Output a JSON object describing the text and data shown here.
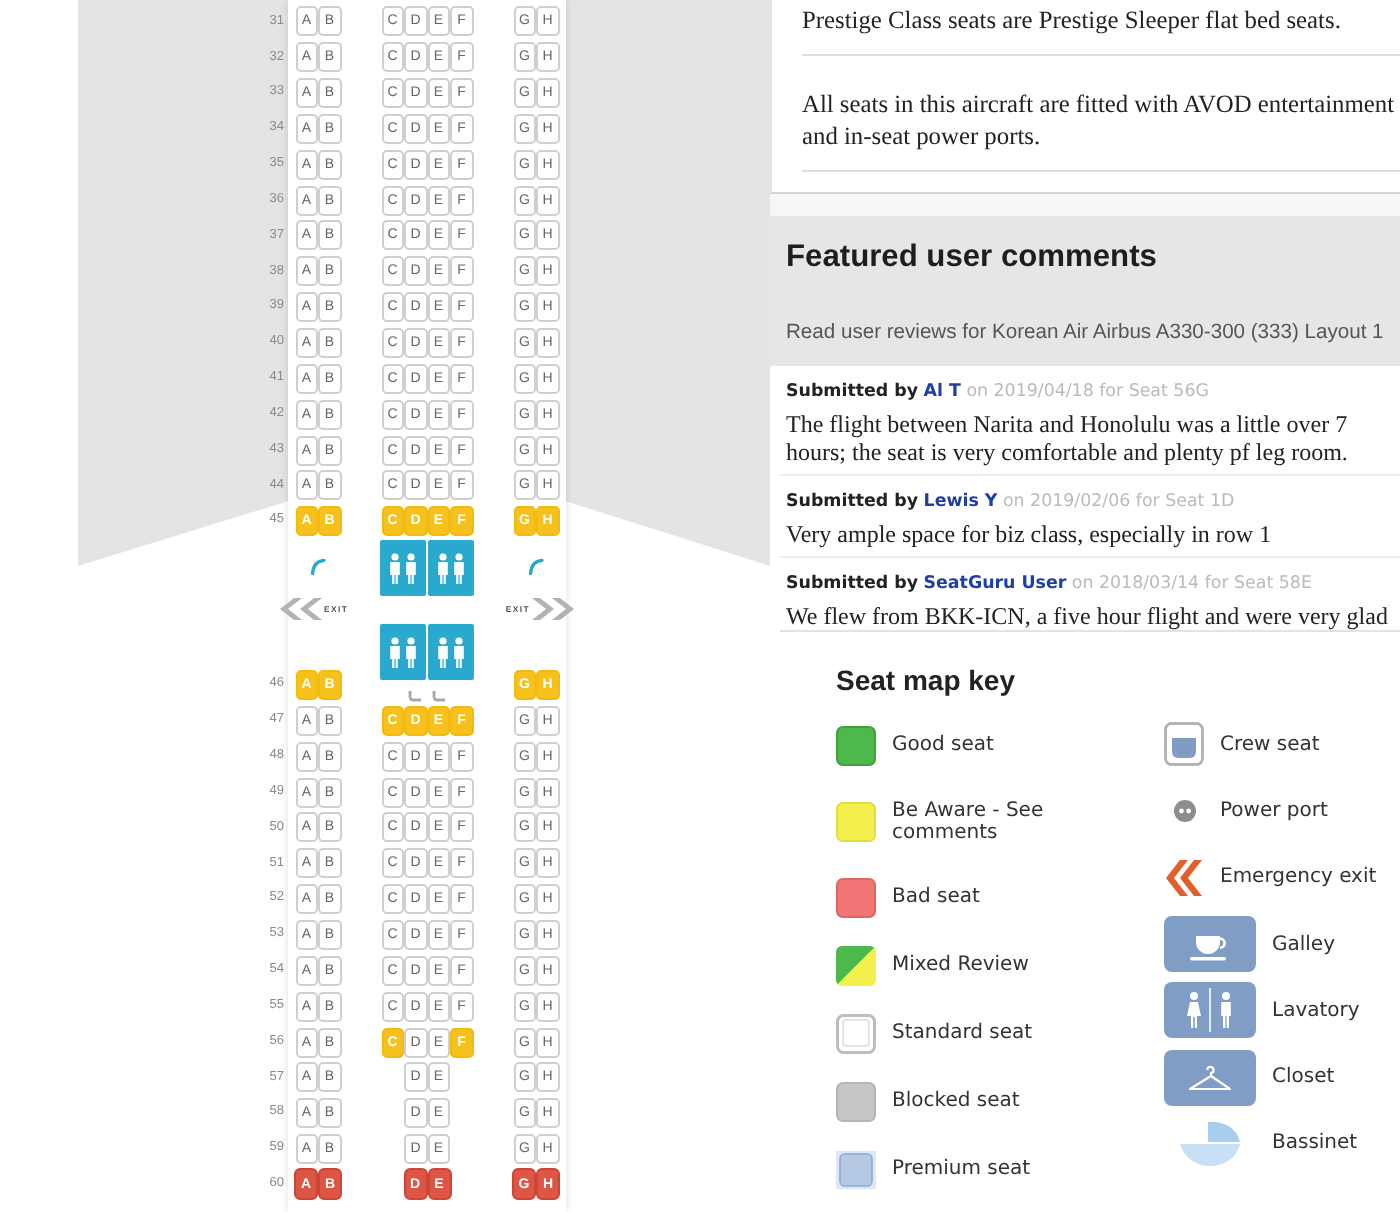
{
  "cabin": [
    {
      "kind": "seats",
      "number": "31",
      "left": [
        {
          "letter": "A",
          "kind": "standard"
        },
        {
          "letter": "B",
          "kind": "standard"
        }
      ],
      "center": [
        {
          "letter": "C",
          "kind": "standard"
        },
        {
          "letter": "D",
          "kind": "standard"
        },
        {
          "letter": "E",
          "kind": "standard"
        },
        {
          "letter": "F",
          "kind": "standard"
        }
      ],
      "right": [
        {
          "letter": "G",
          "kind": "standard"
        },
        {
          "letter": "H",
          "kind": "standard"
        }
      ]
    },
    {
      "kind": "seats",
      "number": "32",
      "left": [
        {
          "letter": "A",
          "kind": "standard"
        },
        {
          "letter": "B",
          "kind": "standard"
        }
      ],
      "center": [
        {
          "letter": "C",
          "kind": "standard"
        },
        {
          "letter": "D",
          "kind": "standard"
        },
        {
          "letter": "E",
          "kind": "standard"
        },
        {
          "letter": "F",
          "kind": "standard"
        }
      ],
      "right": [
        {
          "letter": "G",
          "kind": "standard"
        },
        {
          "letter": "H",
          "kind": "standard"
        }
      ]
    },
    {
      "kind": "seats",
      "number": "33",
      "left": [
        {
          "letter": "A",
          "kind": "standard"
        },
        {
          "letter": "B",
          "kind": "standard"
        }
      ],
      "center": [
        {
          "letter": "C",
          "kind": "standard"
        },
        {
          "letter": "D",
          "kind": "standard"
        },
        {
          "letter": "E",
          "kind": "standard"
        },
        {
          "letter": "F",
          "kind": "standard"
        }
      ],
      "right": [
        {
          "letter": "G",
          "kind": "standard"
        },
        {
          "letter": "H",
          "kind": "standard"
        }
      ]
    },
    {
      "kind": "seats",
      "number": "34",
      "left": [
        {
          "letter": "A",
          "kind": "standard"
        },
        {
          "letter": "B",
          "kind": "standard"
        }
      ],
      "center": [
        {
          "letter": "C",
          "kind": "standard"
        },
        {
          "letter": "D",
          "kind": "standard"
        },
        {
          "letter": "E",
          "kind": "standard"
        },
        {
          "letter": "F",
          "kind": "standard"
        }
      ],
      "right": [
        {
          "letter": "G",
          "kind": "standard"
        },
        {
          "letter": "H",
          "kind": "standard"
        }
      ]
    },
    {
      "kind": "seats",
      "number": "35",
      "left": [
        {
          "letter": "A",
          "kind": "standard"
        },
        {
          "letter": "B",
          "kind": "standard"
        }
      ],
      "center": [
        {
          "letter": "C",
          "kind": "standard"
        },
        {
          "letter": "D",
          "kind": "standard"
        },
        {
          "letter": "E",
          "kind": "standard"
        },
        {
          "letter": "F",
          "kind": "standard"
        }
      ],
      "right": [
        {
          "letter": "G",
          "kind": "standard"
        },
        {
          "letter": "H",
          "kind": "standard"
        }
      ]
    },
    {
      "kind": "seats",
      "number": "36",
      "left": [
        {
          "letter": "A",
          "kind": "standard"
        },
        {
          "letter": "B",
          "kind": "standard"
        }
      ],
      "center": [
        {
          "letter": "C",
          "kind": "standard"
        },
        {
          "letter": "D",
          "kind": "standard"
        },
        {
          "letter": "E",
          "kind": "standard"
        },
        {
          "letter": "F",
          "kind": "standard"
        }
      ],
      "right": [
        {
          "letter": "G",
          "kind": "standard"
        },
        {
          "letter": "H",
          "kind": "standard"
        }
      ]
    },
    {
      "kind": "seats",
      "number": "37",
      "left": [
        {
          "letter": "A",
          "kind": "standard"
        },
        {
          "letter": "B",
          "kind": "standard"
        }
      ],
      "center": [
        {
          "letter": "C",
          "kind": "standard"
        },
        {
          "letter": "D",
          "kind": "standard"
        },
        {
          "letter": "E",
          "kind": "standard"
        },
        {
          "letter": "F",
          "kind": "standard"
        }
      ],
      "right": [
        {
          "letter": "G",
          "kind": "standard"
        },
        {
          "letter": "H",
          "kind": "standard"
        }
      ]
    },
    {
      "kind": "seats",
      "number": "38",
      "left": [
        {
          "letter": "A",
          "kind": "standard"
        },
        {
          "letter": "B",
          "kind": "standard"
        }
      ],
      "center": [
        {
          "letter": "C",
          "kind": "standard"
        },
        {
          "letter": "D",
          "kind": "standard"
        },
        {
          "letter": "E",
          "kind": "standard"
        },
        {
          "letter": "F",
          "kind": "standard"
        }
      ],
      "right": [
        {
          "letter": "G",
          "kind": "standard"
        },
        {
          "letter": "H",
          "kind": "standard"
        }
      ]
    },
    {
      "kind": "seats",
      "number": "39",
      "left": [
        {
          "letter": "A",
          "kind": "standard"
        },
        {
          "letter": "B",
          "kind": "standard"
        }
      ],
      "center": [
        {
          "letter": "C",
          "kind": "standard"
        },
        {
          "letter": "D",
          "kind": "standard"
        },
        {
          "letter": "E",
          "kind": "standard"
        },
        {
          "letter": "F",
          "kind": "standard"
        }
      ],
      "right": [
        {
          "letter": "G",
          "kind": "standard"
        },
        {
          "letter": "H",
          "kind": "standard"
        }
      ]
    },
    {
      "kind": "seats",
      "number": "40",
      "left": [
        {
          "letter": "A",
          "kind": "standard"
        },
        {
          "letter": "B",
          "kind": "standard"
        }
      ],
      "center": [
        {
          "letter": "C",
          "kind": "standard"
        },
        {
          "letter": "D",
          "kind": "standard"
        },
        {
          "letter": "E",
          "kind": "standard"
        },
        {
          "letter": "F",
          "kind": "standard"
        }
      ],
      "right": [
        {
          "letter": "G",
          "kind": "standard"
        },
        {
          "letter": "H",
          "kind": "standard"
        }
      ]
    },
    {
      "kind": "seats",
      "number": "41",
      "left": [
        {
          "letter": "A",
          "kind": "standard"
        },
        {
          "letter": "B",
          "kind": "standard"
        }
      ],
      "center": [
        {
          "letter": "C",
          "kind": "standard"
        },
        {
          "letter": "D",
          "kind": "standard"
        },
        {
          "letter": "E",
          "kind": "standard"
        },
        {
          "letter": "F",
          "kind": "standard"
        }
      ],
      "right": [
        {
          "letter": "G",
          "kind": "standard"
        },
        {
          "letter": "H",
          "kind": "standard"
        }
      ]
    },
    {
      "kind": "seats",
      "number": "42",
      "left": [
        {
          "letter": "A",
          "kind": "standard"
        },
        {
          "letter": "B",
          "kind": "standard"
        }
      ],
      "center": [
        {
          "letter": "C",
          "kind": "standard"
        },
        {
          "letter": "D",
          "kind": "standard"
        },
        {
          "letter": "E",
          "kind": "standard"
        },
        {
          "letter": "F",
          "kind": "standard"
        }
      ],
      "right": [
        {
          "letter": "G",
          "kind": "standard"
        },
        {
          "letter": "H",
          "kind": "standard"
        }
      ]
    },
    {
      "kind": "seats",
      "number": "43",
      "left": [
        {
          "letter": "A",
          "kind": "standard"
        },
        {
          "letter": "B",
          "kind": "standard"
        }
      ],
      "center": [
        {
          "letter": "C",
          "kind": "standard"
        },
        {
          "letter": "D",
          "kind": "standard"
        },
        {
          "letter": "E",
          "kind": "standard"
        },
        {
          "letter": "F",
          "kind": "standard"
        }
      ],
      "right": [
        {
          "letter": "G",
          "kind": "standard"
        },
        {
          "letter": "H",
          "kind": "standard"
        }
      ]
    },
    {
      "kind": "seats",
      "number": "44",
      "left": [
        {
          "letter": "A",
          "kind": "standard"
        },
        {
          "letter": "B",
          "kind": "standard"
        }
      ],
      "center": [
        {
          "letter": "C",
          "kind": "standard"
        },
        {
          "letter": "D",
          "kind": "standard"
        },
        {
          "letter": "E",
          "kind": "standard"
        },
        {
          "letter": "F",
          "kind": "standard"
        }
      ],
      "right": [
        {
          "letter": "G",
          "kind": "standard"
        },
        {
          "letter": "H",
          "kind": "standard"
        }
      ]
    },
    {
      "kind": "seats",
      "number": "45",
      "left": [
        {
          "letter": "A",
          "kind": "be_aware"
        },
        {
          "letter": "B",
          "kind": "be_aware"
        }
      ],
      "center": [
        {
          "letter": "C",
          "kind": "be_aware"
        },
        {
          "letter": "D",
          "kind": "be_aware"
        },
        {
          "letter": "E",
          "kind": "be_aware"
        },
        {
          "letter": "F",
          "kind": "be_aware"
        }
      ],
      "right": [
        {
          "letter": "G",
          "kind": "be_aware"
        },
        {
          "letter": "H",
          "kind": "be_aware"
        }
      ]
    },
    {
      "kind": "exit_zone",
      "exit_labels": [
        "EXIT",
        "EXIT"
      ]
    },
    {
      "kind": "seats",
      "number": "46",
      "left": [
        {
          "letter": "A",
          "kind": "be_aware"
        },
        {
          "letter": "B",
          "kind": "be_aware"
        }
      ],
      "center": [
        {
          "kind": "curl"
        },
        {
          "kind": "curl"
        }
      ],
      "right": [
        {
          "letter": "G",
          "kind": "be_aware"
        },
        {
          "letter": "H",
          "kind": "be_aware"
        }
      ]
    },
    {
      "kind": "seats",
      "number": "47",
      "left": [
        {
          "letter": "A",
          "kind": "standard"
        },
        {
          "letter": "B",
          "kind": "standard"
        }
      ],
      "center": [
        {
          "letter": "C",
          "kind": "be_aware"
        },
        {
          "letter": "D",
          "kind": "be_aware"
        },
        {
          "letter": "E",
          "kind": "be_aware"
        },
        {
          "letter": "F",
          "kind": "be_aware"
        }
      ],
      "right": [
        {
          "letter": "G",
          "kind": "standard"
        },
        {
          "letter": "H",
          "kind": "standard"
        }
      ]
    },
    {
      "kind": "seats",
      "number": "48",
      "left": [
        {
          "letter": "A",
          "kind": "standard"
        },
        {
          "letter": "B",
          "kind": "standard"
        }
      ],
      "center": [
        {
          "letter": "C",
          "kind": "standard"
        },
        {
          "letter": "D",
          "kind": "standard"
        },
        {
          "letter": "E",
          "kind": "standard"
        },
        {
          "letter": "F",
          "kind": "standard"
        }
      ],
      "right": [
        {
          "letter": "G",
          "kind": "standard"
        },
        {
          "letter": "H",
          "kind": "standard"
        }
      ]
    },
    {
      "kind": "seats",
      "number": "49",
      "left": [
        {
          "letter": "A",
          "kind": "standard"
        },
        {
          "letter": "B",
          "kind": "standard"
        }
      ],
      "center": [
        {
          "letter": "C",
          "kind": "standard"
        },
        {
          "letter": "D",
          "kind": "standard"
        },
        {
          "letter": "E",
          "kind": "standard"
        },
        {
          "letter": "F",
          "kind": "standard"
        }
      ],
      "right": [
        {
          "letter": "G",
          "kind": "standard"
        },
        {
          "letter": "H",
          "kind": "standard"
        }
      ]
    },
    {
      "kind": "seats",
      "number": "50",
      "left": [
        {
          "letter": "A",
          "kind": "standard"
        },
        {
          "letter": "B",
          "kind": "standard"
        }
      ],
      "center": [
        {
          "letter": "C",
          "kind": "standard"
        },
        {
          "letter": "D",
          "kind": "standard"
        },
        {
          "letter": "E",
          "kind": "standard"
        },
        {
          "letter": "F",
          "kind": "standard"
        }
      ],
      "right": [
        {
          "letter": "G",
          "kind": "standard"
        },
        {
          "letter": "H",
          "kind": "standard"
        }
      ]
    },
    {
      "kind": "seats",
      "number": "51",
      "left": [
        {
          "letter": "A",
          "kind": "standard"
        },
        {
          "letter": "B",
          "kind": "standard"
        }
      ],
      "center": [
        {
          "letter": "C",
          "kind": "standard"
        },
        {
          "letter": "D",
          "kind": "standard"
        },
        {
          "letter": "E",
          "kind": "standard"
        },
        {
          "letter": "F",
          "kind": "standard"
        }
      ],
      "right": [
        {
          "letter": "G",
          "kind": "standard"
        },
        {
          "letter": "H",
          "kind": "standard"
        }
      ]
    },
    {
      "kind": "seats",
      "number": "52",
      "left": [
        {
          "letter": "A",
          "kind": "standard"
        },
        {
          "letter": "B",
          "kind": "standard"
        }
      ],
      "center": [
        {
          "letter": "C",
          "kind": "standard"
        },
        {
          "letter": "D",
          "kind": "standard"
        },
        {
          "letter": "E",
          "kind": "standard"
        },
        {
          "letter": "F",
          "kind": "standard"
        }
      ],
      "right": [
        {
          "letter": "G",
          "kind": "standard"
        },
        {
          "letter": "H",
          "kind": "standard"
        }
      ]
    },
    {
      "kind": "seats",
      "number": "53",
      "left": [
        {
          "letter": "A",
          "kind": "standard"
        },
        {
          "letter": "B",
          "kind": "standard"
        }
      ],
      "center": [
        {
          "letter": "C",
          "kind": "standard"
        },
        {
          "letter": "D",
          "kind": "standard"
        },
        {
          "letter": "E",
          "kind": "standard"
        },
        {
          "letter": "F",
          "kind": "standard"
        }
      ],
      "right": [
        {
          "letter": "G",
          "kind": "standard"
        },
        {
          "letter": "H",
          "kind": "standard"
        }
      ]
    },
    {
      "kind": "seats",
      "number": "54",
      "left": [
        {
          "letter": "A",
          "kind": "standard"
        },
        {
          "letter": "B",
          "kind": "standard"
        }
      ],
      "center": [
        {
          "letter": "C",
          "kind": "standard"
        },
        {
          "letter": "D",
          "kind": "standard"
        },
        {
          "letter": "E",
          "kind": "standard"
        },
        {
          "letter": "F",
          "kind": "standard"
        }
      ],
      "right": [
        {
          "letter": "G",
          "kind": "standard"
        },
        {
          "letter": "H",
          "kind": "standard"
        }
      ]
    },
    {
      "kind": "seats",
      "number": "55",
      "left": [
        {
          "letter": "A",
          "kind": "standard"
        },
        {
          "letter": "B",
          "kind": "standard"
        }
      ],
      "center": [
        {
          "letter": "C",
          "kind": "standard"
        },
        {
          "letter": "D",
          "kind": "standard"
        },
        {
          "letter": "E",
          "kind": "standard"
        },
        {
          "letter": "F",
          "kind": "standard"
        }
      ],
      "right": [
        {
          "letter": "G",
          "kind": "standard"
        },
        {
          "letter": "H",
          "kind": "standard"
        }
      ]
    },
    {
      "kind": "seats",
      "number": "56",
      "left": [
        {
          "letter": "A",
          "kind": "standard"
        },
        {
          "letter": "B",
          "kind": "standard"
        }
      ],
      "center": [
        {
          "letter": "C",
          "kind": "be_aware"
        },
        {
          "letter": "D",
          "kind": "standard"
        },
        {
          "letter": "E",
          "kind": "standard"
        },
        {
          "letter": "F",
          "kind": "be_aware"
        }
      ],
      "right": [
        {
          "letter": "G",
          "kind": "standard"
        },
        {
          "letter": "H",
          "kind": "standard"
        }
      ]
    },
    {
      "kind": "seats",
      "number": "57",
      "left": [
        {
          "letter": "A",
          "kind": "standard"
        },
        {
          "letter": "B",
          "kind": "standard"
        }
      ],
      "center": [
        {
          "letter": "D",
          "kind": "standard"
        },
        {
          "letter": "E",
          "kind": "standard"
        }
      ],
      "right": [
        {
          "letter": "G",
          "kind": "standard"
        },
        {
          "letter": "H",
          "kind": "standard"
        }
      ]
    },
    {
      "kind": "seats",
      "number": "58",
      "left": [
        {
          "letter": "A",
          "kind": "standard"
        },
        {
          "letter": "B",
          "kind": "standard"
        }
      ],
      "center": [
        {
          "letter": "D",
          "kind": "standard"
        },
        {
          "letter": "E",
          "kind": "standard"
        }
      ],
      "right": [
        {
          "letter": "G",
          "kind": "standard"
        },
        {
          "letter": "H",
          "kind": "standard"
        }
      ]
    },
    {
      "kind": "seats",
      "number": "59",
      "left": [
        {
          "letter": "A",
          "kind": "standard"
        },
        {
          "letter": "B",
          "kind": "standard"
        }
      ],
      "center": [
        {
          "letter": "D",
          "kind": "standard"
        },
        {
          "letter": "E",
          "kind": "standard"
        }
      ],
      "right": [
        {
          "letter": "G",
          "kind": "standard"
        },
        {
          "letter": "H",
          "kind": "standard"
        }
      ]
    },
    {
      "kind": "seats",
      "number": "60",
      "left": [
        {
          "letter": "A",
          "kind": "bad"
        },
        {
          "letter": "B",
          "kind": "bad"
        }
      ],
      "center": [
        {
          "letter": "D",
          "kind": "bad"
        },
        {
          "letter": "E",
          "kind": "bad"
        }
      ],
      "right": [
        {
          "letter": "G",
          "kind": "bad"
        },
        {
          "letter": "H",
          "kind": "bad"
        }
      ]
    }
  ],
  "info_notes": [
    "Prestige Class seats are Prestige Sleeper flat bed seats.",
    "All seats in this aircraft are fitted with AVOD entertainment and in-seat power ports."
  ],
  "featured_comments": {
    "title": "Featured user comments",
    "subtitle": "Read user reviews for Korean Air Airbus A330-300 (333) Layout 1",
    "comments": [
      {
        "label": "Submitted by",
        "author": "Al T",
        "details": "on 2019/04/18 for Seat 56G",
        "text": "The flight between Narita and Honolulu was a little over 7 hours; the seat is very comfortable and plenty pf leg room."
      },
      {
        "label": "Submitted by",
        "author": "Lewis Y",
        "details": "on 2019/02/06 for Seat 1D",
        "text": "Very ample space for biz class, especially in row 1"
      },
      {
        "label": "Submitted by",
        "author": "SeatGuru User",
        "details": "on 2018/03/14 for Seat 58E",
        "text": "We flew from BKK-ICN, a five hour flight and were very glad"
      }
    ]
  },
  "seat_map_key": {
    "title": "Seat map key",
    "left_items": [
      {
        "kind": "good",
        "label": "Good seat"
      },
      {
        "kind": "be_aware",
        "label": "Be Aware - See comments"
      },
      {
        "kind": "bad",
        "label": "Bad seat"
      },
      {
        "kind": "mixed",
        "label": "Mixed Review"
      },
      {
        "kind": "standard",
        "label": "Standard seat"
      },
      {
        "kind": "blocked",
        "label": "Blocked seat"
      },
      {
        "kind": "premium",
        "label": "Premium seat"
      }
    ],
    "right_items": [
      {
        "kind": "crew",
        "label": "Crew seat"
      },
      {
        "kind": "power",
        "label": "Power port"
      },
      {
        "kind": "exit",
        "label": "Emergency exit"
      },
      {
        "kind": "galley",
        "label": "Galley"
      },
      {
        "kind": "lavatory",
        "label": "Lavatory"
      },
      {
        "kind": "closet",
        "label": "Closet"
      },
      {
        "kind": "bassinet",
        "label": "Bassinet"
      }
    ]
  }
}
